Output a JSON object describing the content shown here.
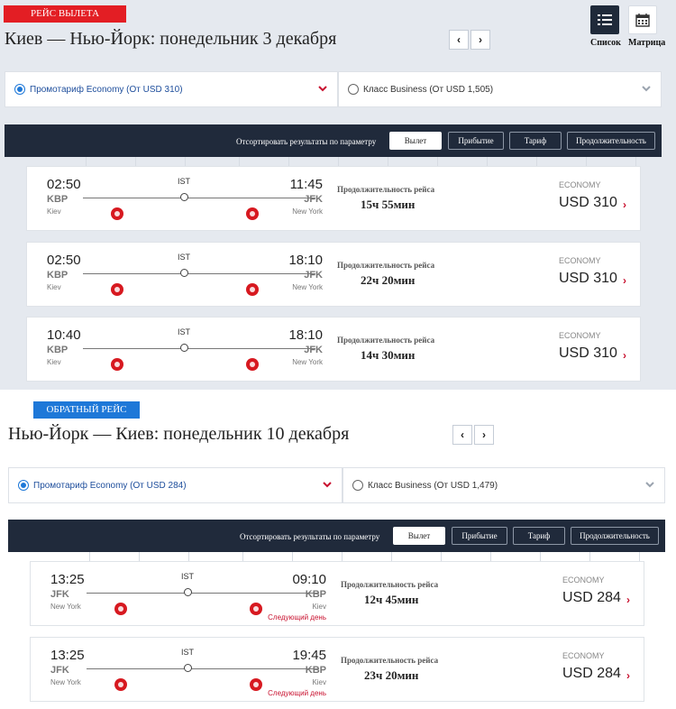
{
  "outbound": {
    "badge": "РЕЙС ВЫЛЕТА",
    "title": "Киев — Нью-Йорк: понедельник 3 декабря",
    "prev": "‹",
    "next": "›",
    "fares": {
      "economy": "Промотариф Economy (От USD 310)",
      "business": "Класс Business (От USD 1,505)"
    },
    "sort": {
      "label": "Отсортировать результаты по параметру",
      "departure": "Вылет",
      "arrival": "Прибытие",
      "fare": "Тариф",
      "duration": "Продолжительность"
    },
    "flights": [
      {
        "dep_time": "02:50",
        "dep_code": "KBP",
        "dep_city": "Kiev",
        "via": "IST",
        "arr_time": "11:45",
        "arr_code": "JFK",
        "arr_city": "New York",
        "dur_label": "Продолжительность рейса",
        "duration": "15ч 55мин",
        "cabin": "ECONOMY",
        "price": "USD 310"
      },
      {
        "dep_time": "02:50",
        "dep_code": "KBP",
        "dep_city": "Kiev",
        "via": "IST",
        "arr_time": "18:10",
        "arr_code": "JFK",
        "arr_city": "New York",
        "dur_label": "Продолжительность рейса",
        "duration": "22ч 20мин",
        "cabin": "ECONOMY",
        "price": "USD 310"
      },
      {
        "dep_time": "10:40",
        "dep_code": "KBP",
        "dep_city": "Kiev",
        "via": "IST",
        "arr_time": "18:10",
        "arr_code": "JFK",
        "arr_city": "New York",
        "dur_label": "Продолжительность рейса",
        "duration": "14ч 30мин",
        "cabin": "ECONOMY",
        "price": "USD 310"
      }
    ]
  },
  "view": {
    "list": "Список",
    "matrix": "Матрица"
  },
  "return": {
    "badge": "ОБРАТНЫЙ РЕЙС",
    "title": "Нью-Йорк — Киев: понедельник 10 декабря",
    "prev": "‹",
    "next": "›",
    "fares": {
      "economy": "Промотариф Economy (От USD 284)",
      "business": "Класс Business (От USD 1,479)"
    },
    "sort": {
      "label": "Отсортировать результаты по параметру",
      "departure": "Вылет",
      "arrival": "Прибытие",
      "fare": "Тариф",
      "duration": "Продолжительность"
    },
    "flights": [
      {
        "dep_time": "13:25",
        "dep_code": "JFK",
        "dep_city": "New York",
        "via": "IST",
        "arr_time": "09:10",
        "arr_code": "KBP",
        "arr_city": "Kiev",
        "next_day": "Следующий день",
        "dur_label": "Продолжительность рейса",
        "duration": "12ч 45мин",
        "cabin": "ECONOMY",
        "price": "USD 284"
      },
      {
        "dep_time": "13:25",
        "dep_code": "JFK",
        "dep_city": "New York",
        "via": "IST",
        "arr_time": "19:45",
        "arr_code": "KBP",
        "arr_city": "Kiev",
        "next_day": "Следующий день",
        "dur_label": "Продолжительность рейса",
        "duration": "23ч 20мин",
        "cabin": "ECONOMY",
        "price": "USD 284"
      }
    ]
  },
  "colors": {
    "accent_red": "#e31e24",
    "accent_blue": "#1e78d8",
    "sort_bar": "#202a3b"
  },
  "icons": [
    "list-icon",
    "calendar-icon",
    "chevron-down-icon",
    "chevron-right-icon",
    "turkish-airlines-logo"
  ]
}
